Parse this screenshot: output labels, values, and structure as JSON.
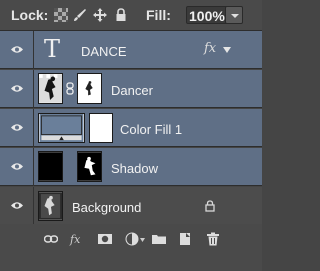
{
  "toolbar": {
    "lock_label": "Lock:",
    "fill_label": "Fill:",
    "fill_value": "100%",
    "lock_icons": [
      "lock-transparent-pixels-icon",
      "lock-image-pixels-icon",
      "lock-position-icon",
      "lock-all-icon"
    ]
  },
  "layers": [
    {
      "name": "DANCE",
      "type": "text",
      "thumb_glyph": "T",
      "fx_label": "fx",
      "selected": true,
      "visible": true
    },
    {
      "name": "Dancer",
      "type": "masked",
      "selected": true,
      "visible": true
    },
    {
      "name": "Color Fill 1",
      "type": "fill",
      "selected": true,
      "visible": true
    },
    {
      "name": "Shadow",
      "type": "masked",
      "selected": true,
      "visible": true
    },
    {
      "name": "Background",
      "type": "background",
      "selected": false,
      "locked": true,
      "visible": true
    }
  ],
  "bottom_icons": [
    "link-layers-icon",
    "layer-style-icon",
    "layer-mask-icon",
    "adjustment-layer-icon",
    "new-group-icon",
    "new-layer-icon",
    "delete-layer-icon"
  ],
  "colors": {
    "selected_row": "#5f6f86",
    "panel_bg": "#4c4c4c",
    "fill_swatch": "#6a7f9a"
  }
}
